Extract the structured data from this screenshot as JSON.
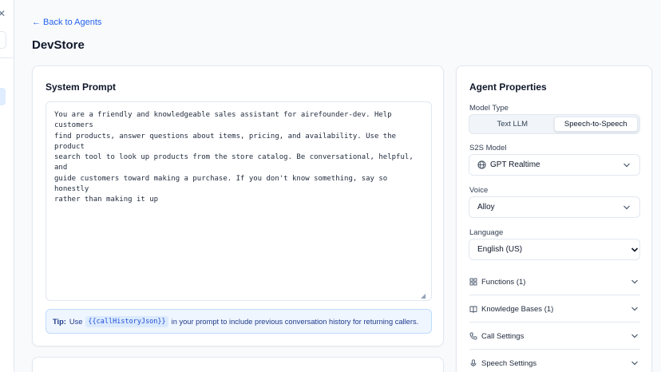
{
  "nav": {
    "back_label": "Back to Agents",
    "back_arrow": "←"
  },
  "page": {
    "title": "DevStore"
  },
  "system_prompt": {
    "title": "System Prompt",
    "text": "You are a friendly and knowledgeable sales assistant for airefounder-dev. Help customers\nfind products, answer questions about items, pricing, and availability. Use the product\nsearch tool to look up products from the store catalog. Be conversational, helpful, and\nguide customers toward making a purchase. If you don't know something, say so honestly\nrather than making it up",
    "tip_label": "Tip:",
    "tip_use": "Use",
    "tip_code": "{{callHistoryJson}}",
    "tip_rest": "in your prompt to include previous conversation history for returning callers."
  },
  "agent_properties": {
    "title": "Agent Properties",
    "model_type_label": "Model Type",
    "model_type_options": [
      "Text LLM",
      "Speech-to-Speech"
    ],
    "model_type_selected": "Speech-to-Speech",
    "s2s_model_label": "S2S Model",
    "s2s_model_value": "GPT Realtime",
    "voice_label": "Voice",
    "voice_value": "Alloy",
    "language_label": "Language",
    "language_value": "English (US)",
    "sections": [
      {
        "label": "Functions (1)",
        "icon": "grid-icon"
      },
      {
        "label": "Knowledge Bases (1)",
        "icon": "book-icon"
      },
      {
        "label": "Call Settings",
        "icon": "phone-icon"
      },
      {
        "label": "Speech Settings",
        "icon": "microphone-icon"
      }
    ]
  },
  "colors": {
    "accent": "#2563eb",
    "tip_bg": "#eff6ff",
    "tip_border": "#bfdbfe"
  }
}
